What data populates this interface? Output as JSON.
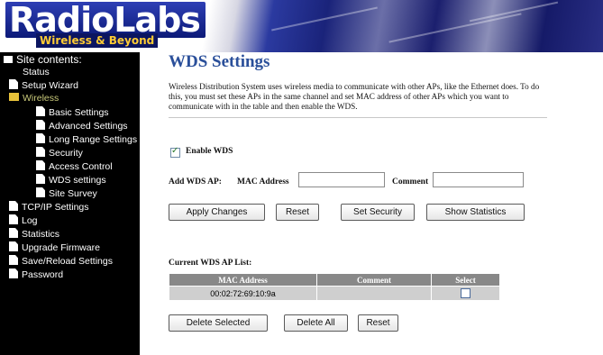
{
  "brand": {
    "name": "RadioLabs",
    "tagline": "Wireless & Beyond"
  },
  "sidebar": {
    "title": "Site contents:",
    "items": [
      {
        "label": "Status",
        "level": 1,
        "type": "page"
      },
      {
        "label": "Setup Wizard",
        "level": 1,
        "type": "page"
      },
      {
        "label": "Wireless",
        "level": 1,
        "type": "folder-open",
        "active": true
      },
      {
        "label": "Basic Settings",
        "level": 2,
        "type": "page"
      },
      {
        "label": "Advanced Settings",
        "level": 2,
        "type": "page"
      },
      {
        "label": "Long Range Settings",
        "level": 2,
        "type": "page"
      },
      {
        "label": "Security",
        "level": 2,
        "type": "page"
      },
      {
        "label": "Access Control",
        "level": 2,
        "type": "page"
      },
      {
        "label": "WDS settings",
        "level": 2,
        "type": "page"
      },
      {
        "label": "Site Survey",
        "level": 2,
        "type": "page"
      },
      {
        "label": "TCP/IP Settings",
        "level": 1,
        "type": "page"
      },
      {
        "label": "Log",
        "level": 1,
        "type": "page"
      },
      {
        "label": "Statistics",
        "level": 1,
        "type": "page"
      },
      {
        "label": "Upgrade Firmware",
        "level": 1,
        "type": "page"
      },
      {
        "label": "Save/Reload Settings",
        "level": 1,
        "type": "page"
      },
      {
        "label": "Password",
        "level": 1,
        "type": "page"
      }
    ]
  },
  "main": {
    "title": "WDS Settings",
    "description": "Wireless Distribution System uses wireless media to communicate with other APs, like the Ethernet does. To do this, you must set these APs in the same channel and set MAC address of other APs which you want to communicate with in the table and then enable the WDS.",
    "enable_label": "Enable WDS",
    "enable_checked": true,
    "add_label": "Add WDS AP:",
    "mac_label": "MAC Address",
    "mac_value": "",
    "comment_label": "Comment",
    "comment_value": "",
    "buttons": {
      "apply": "Apply Changes",
      "reset": "Reset",
      "security": "Set Security",
      "stats": "Show Statistics"
    },
    "list_title": "Current WDS AP List:",
    "table": {
      "headers": [
        "MAC Address",
        "Comment",
        "Select"
      ],
      "rows": [
        {
          "mac": "00:02:72:69:10:9a",
          "comment": "",
          "selected": false
        }
      ]
    },
    "list_buttons": {
      "delete_selected": "Delete Selected",
      "delete_all": "Delete All",
      "reset": "Reset"
    }
  },
  "colors": {
    "title": "#2a4f9a",
    "sidebar_bg": "#000000",
    "active_nav": "#c9c97a",
    "table_header": "#888888",
    "table_cell": "#cfcfcf"
  }
}
